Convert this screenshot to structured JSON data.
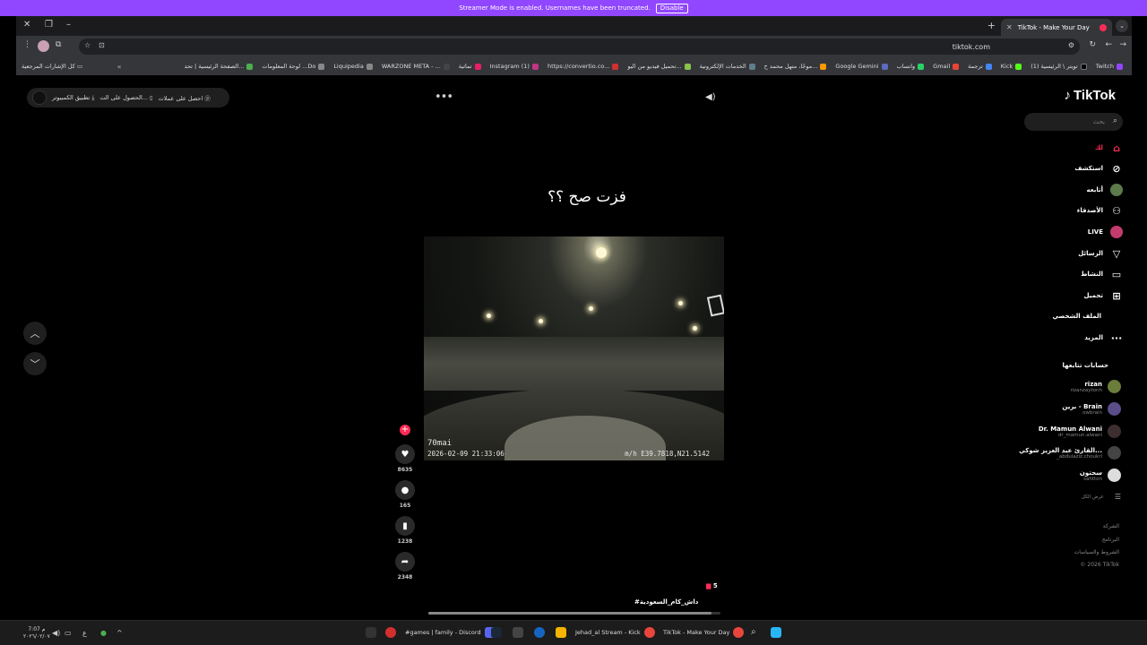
{
  "streamer_banner": {
    "text": "Streamer Mode is enabled. Usernames have been truncated.",
    "button": "Disable"
  },
  "browser": {
    "tab_title": "TikTok - Make Your Day",
    "url": "tiktok.com",
    "all_bookmarks": "كل الإشارات المرجعية",
    "bookmarks": [
      "Twitch",
      "تويتر \\ الرئيسية (1)",
      "Kick",
      "ترجمة",
      "Gmail",
      "واتساب",
      "Google Gemini",
      "موحًا، متهل محمد ح...",
      "الخدمات الإلكترونية",
      "تحميل فيديو من اليو...",
      "https://convertio.co...",
      "Instagram (1)",
      "تماثية",
      "WARZONE META - ...",
      "Liquipedia",
      "لوحة المعلومات ...Do",
      "الصفحة الرئيسية | تحد..."
    ]
  },
  "tiktok": {
    "logo": "TikTok",
    "search_placeholder": "بحث",
    "nav": [
      "لك",
      "استكشف",
      "أتابعه",
      "الأصدقاء",
      "LIVE",
      "الرسائل",
      "النشاط",
      "تحميل",
      "الملف الشخصي",
      "المزيد"
    ],
    "following_title": "حسابات تتابعها",
    "following": [
      {
        "name": "rizan",
        "user": "rizanzaytonh"
      },
      {
        "name": "برين - Brain",
        "user": "owbrain"
      },
      {
        "name": "Dr. Mamun Alwani",
        "user": "dr_mamun.alwani"
      },
      {
        "name": "القارئ عبد العزيز شوكي...",
        "user": "_abdulaziz.choukri"
      },
      {
        "name": "سحتون",
        "user": "sahtton"
      }
    ],
    "see_all": "عرض الكل",
    "footer": [
      "الشركة",
      "البرنامج",
      "الشروط والسياسات",
      "© 2026 TikTok"
    ],
    "top_pill": {
      "coins": "احصل على عملات",
      "get_app": "الحصول على الت...",
      "pc_app": "تطبيق الكمبيوتر"
    },
    "caption": "فزت صح ؟؟",
    "video_osd": {
      "brand": "70mai",
      "datetime": "2026-02-09 21:33:06",
      "gps": "m/h E39.7818,N21.5142"
    },
    "likes": "8635",
    "comments": "165",
    "saves": "1238",
    "shares": "2348",
    "gift_count": "5",
    "hashtag": "#داش_كام_السعودية",
    "progress": 0.97
  },
  "taskbar": {
    "time": "7:07 م",
    "date": "٢٠٢٦/٠٢/٠٧",
    "apps": [
      "#games | family - Discord",
      "Jehad_al Stream - Kick",
      "TikTok - Make Your Day"
    ]
  }
}
